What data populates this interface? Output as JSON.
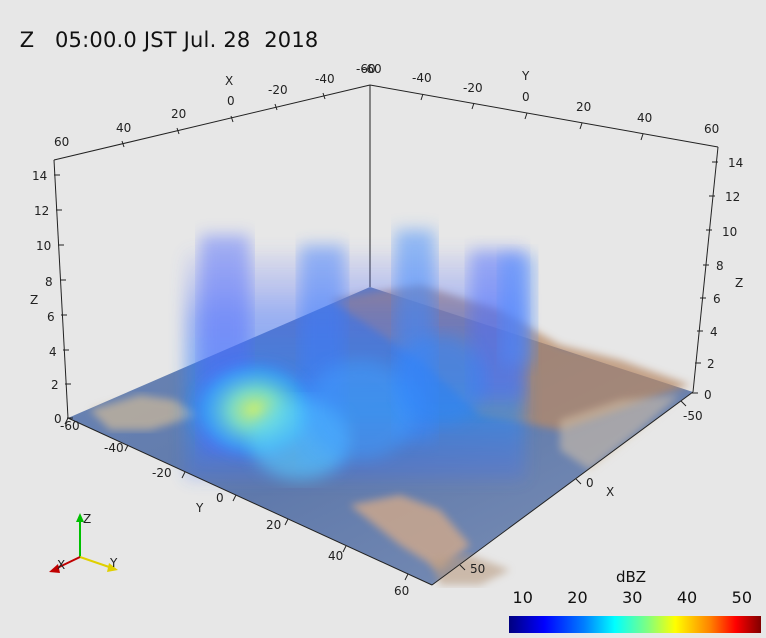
{
  "title": {
    "variable": "Z",
    "time": "05:00.0 JST Jul. 28  2018"
  },
  "axes": {
    "left_z_ticks": [
      "14",
      "12",
      "10",
      "8",
      "6",
      "4",
      "2",
      "0"
    ],
    "right_z_ticks": [
      "14",
      "12",
      "10",
      "8",
      "6",
      "4",
      "2",
      "0"
    ],
    "z_label": "Z",
    "top_left_x_ticks": [
      "60",
      "40",
      "20",
      "0",
      "-20",
      "-40",
      "-60"
    ],
    "top_left_label": "X",
    "top_right_y_ticks": [
      "-60",
      "-40",
      "-20",
      "0",
      "20",
      "40",
      "60"
    ],
    "top_right_label": "Y",
    "bottom_y_ticks": [
      "-60",
      "-40",
      "-20",
      "0",
      "20",
      "40",
      "60"
    ],
    "bottom_y_label": "Y",
    "bottom_x_ticks": [
      "-50",
      "0",
      "50"
    ],
    "bottom_x_label": "X"
  },
  "orientation": {
    "x": "X",
    "y": "Y",
    "z": "Z"
  },
  "colorbar": {
    "title": "dBZ",
    "ticks": [
      "10",
      "20",
      "30",
      "40",
      "50"
    ],
    "tick_values": [
      10,
      20,
      30,
      40,
      50
    ],
    "range": [
      7.5,
      53.5
    ]
  }
}
